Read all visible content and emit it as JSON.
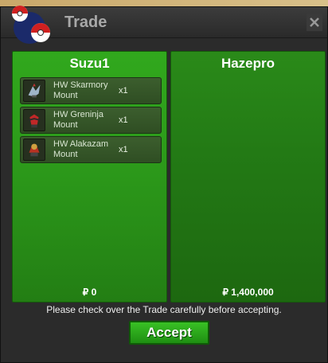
{
  "window": {
    "title": "Trade"
  },
  "left_panel": {
    "player": "Suzu1",
    "items": [
      {
        "name": "HW Skarmory Mount",
        "qty": "x1",
        "icon": "skarmory-mount-icon"
      },
      {
        "name": "HW Greninja Mount",
        "qty": "x1",
        "icon": "greninja-mount-icon"
      },
      {
        "name": "HW Alakazam Mount",
        "qty": "x1",
        "icon": "alakazam-mount-icon"
      }
    ],
    "money": "₽ 0"
  },
  "right_panel": {
    "player": "Hazepro",
    "items": [],
    "money": "₽ 1,400,000"
  },
  "message": "Please check over the Trade carefully before accepting.",
  "accept_label": "Accept",
  "colors": {
    "panel_green": "#2c9a1a",
    "button_green": "#2fae1c",
    "window_bg": "#2b2b2b"
  }
}
